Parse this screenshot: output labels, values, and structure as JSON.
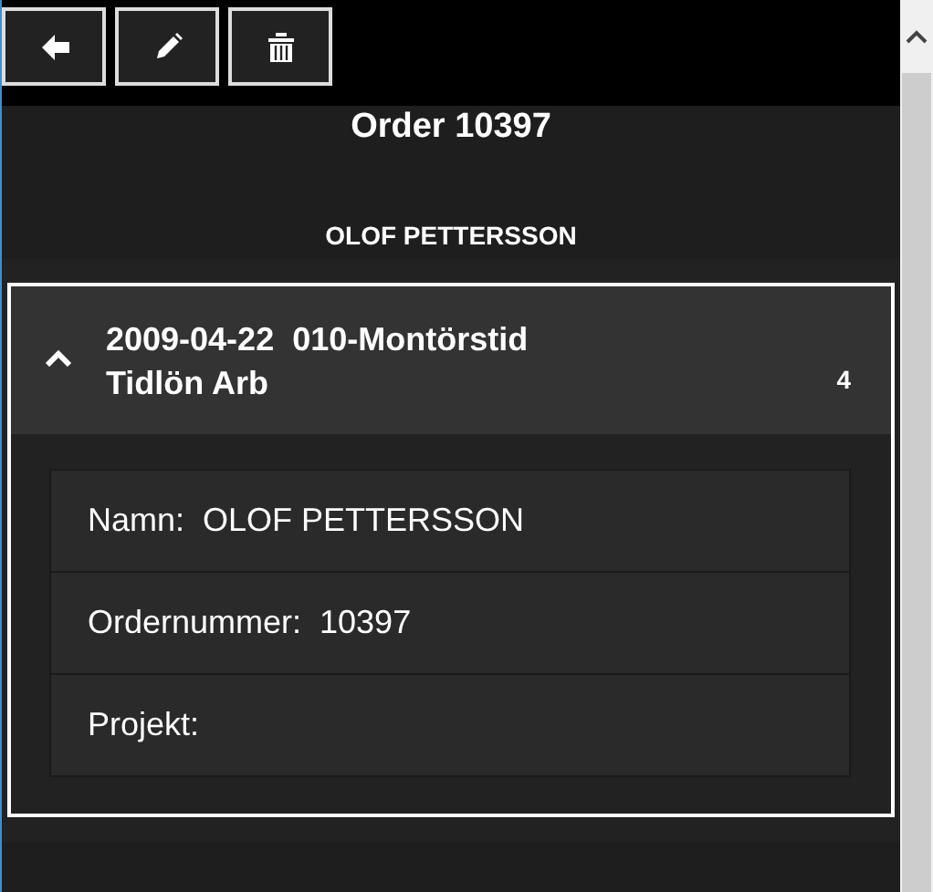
{
  "toolbar": {
    "buttons": [
      {
        "kind": "back"
      },
      {
        "kind": "edit"
      },
      {
        "kind": "delete"
      }
    ]
  },
  "title": "Order 10397",
  "subtitle": "OLOF PETTERSSON",
  "entry": {
    "expanded": true,
    "heading_line_1": "2009-04-22  010-Montörstid",
    "heading_line_2": "Tidlön Arb",
    "count": "4",
    "fields": [
      {
        "label": "Namn:",
        "value": "OLOF PETTERSSON"
      },
      {
        "label": "Ordernummer:",
        "value": "10397"
      },
      {
        "label": "Projekt:"
      }
    ]
  }
}
